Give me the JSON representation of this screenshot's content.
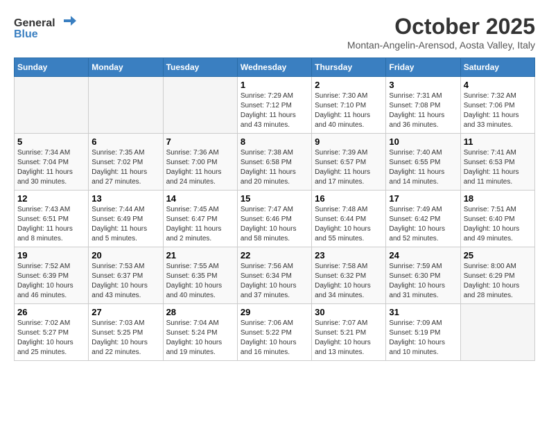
{
  "header": {
    "logo_general": "General",
    "logo_blue": "Blue",
    "month": "October 2025",
    "location": "Montan-Angelin-Arensod, Aosta Valley, Italy"
  },
  "days_of_week": [
    "Sunday",
    "Monday",
    "Tuesday",
    "Wednesday",
    "Thursday",
    "Friday",
    "Saturday"
  ],
  "weeks": [
    [
      {
        "day": "",
        "sunrise": "",
        "sunset": "",
        "daylight": ""
      },
      {
        "day": "",
        "sunrise": "",
        "sunset": "",
        "daylight": ""
      },
      {
        "day": "",
        "sunrise": "",
        "sunset": "",
        "daylight": ""
      },
      {
        "day": "1",
        "sunrise": "Sunrise: 7:29 AM",
        "sunset": "Sunset: 7:12 PM",
        "daylight": "Daylight: 11 hours and 43 minutes."
      },
      {
        "day": "2",
        "sunrise": "Sunrise: 7:30 AM",
        "sunset": "Sunset: 7:10 PM",
        "daylight": "Daylight: 11 hours and 40 minutes."
      },
      {
        "day": "3",
        "sunrise": "Sunrise: 7:31 AM",
        "sunset": "Sunset: 7:08 PM",
        "daylight": "Daylight: 11 hours and 36 minutes."
      },
      {
        "day": "4",
        "sunrise": "Sunrise: 7:32 AM",
        "sunset": "Sunset: 7:06 PM",
        "daylight": "Daylight: 11 hours and 33 minutes."
      }
    ],
    [
      {
        "day": "5",
        "sunrise": "Sunrise: 7:34 AM",
        "sunset": "Sunset: 7:04 PM",
        "daylight": "Daylight: 11 hours and 30 minutes."
      },
      {
        "day": "6",
        "sunrise": "Sunrise: 7:35 AM",
        "sunset": "Sunset: 7:02 PM",
        "daylight": "Daylight: 11 hours and 27 minutes."
      },
      {
        "day": "7",
        "sunrise": "Sunrise: 7:36 AM",
        "sunset": "Sunset: 7:00 PM",
        "daylight": "Daylight: 11 hours and 24 minutes."
      },
      {
        "day": "8",
        "sunrise": "Sunrise: 7:38 AM",
        "sunset": "Sunset: 6:58 PM",
        "daylight": "Daylight: 11 hours and 20 minutes."
      },
      {
        "day": "9",
        "sunrise": "Sunrise: 7:39 AM",
        "sunset": "Sunset: 6:57 PM",
        "daylight": "Daylight: 11 hours and 17 minutes."
      },
      {
        "day": "10",
        "sunrise": "Sunrise: 7:40 AM",
        "sunset": "Sunset: 6:55 PM",
        "daylight": "Daylight: 11 hours and 14 minutes."
      },
      {
        "day": "11",
        "sunrise": "Sunrise: 7:41 AM",
        "sunset": "Sunset: 6:53 PM",
        "daylight": "Daylight: 11 hours and 11 minutes."
      }
    ],
    [
      {
        "day": "12",
        "sunrise": "Sunrise: 7:43 AM",
        "sunset": "Sunset: 6:51 PM",
        "daylight": "Daylight: 11 hours and 8 minutes."
      },
      {
        "day": "13",
        "sunrise": "Sunrise: 7:44 AM",
        "sunset": "Sunset: 6:49 PM",
        "daylight": "Daylight: 11 hours and 5 minutes."
      },
      {
        "day": "14",
        "sunrise": "Sunrise: 7:45 AM",
        "sunset": "Sunset: 6:47 PM",
        "daylight": "Daylight: 11 hours and 2 minutes."
      },
      {
        "day": "15",
        "sunrise": "Sunrise: 7:47 AM",
        "sunset": "Sunset: 6:46 PM",
        "daylight": "Daylight: 10 hours and 58 minutes."
      },
      {
        "day": "16",
        "sunrise": "Sunrise: 7:48 AM",
        "sunset": "Sunset: 6:44 PM",
        "daylight": "Daylight: 10 hours and 55 minutes."
      },
      {
        "day": "17",
        "sunrise": "Sunrise: 7:49 AM",
        "sunset": "Sunset: 6:42 PM",
        "daylight": "Daylight: 10 hours and 52 minutes."
      },
      {
        "day": "18",
        "sunrise": "Sunrise: 7:51 AM",
        "sunset": "Sunset: 6:40 PM",
        "daylight": "Daylight: 10 hours and 49 minutes."
      }
    ],
    [
      {
        "day": "19",
        "sunrise": "Sunrise: 7:52 AM",
        "sunset": "Sunset: 6:39 PM",
        "daylight": "Daylight: 10 hours and 46 minutes."
      },
      {
        "day": "20",
        "sunrise": "Sunrise: 7:53 AM",
        "sunset": "Sunset: 6:37 PM",
        "daylight": "Daylight: 10 hours and 43 minutes."
      },
      {
        "day": "21",
        "sunrise": "Sunrise: 7:55 AM",
        "sunset": "Sunset: 6:35 PM",
        "daylight": "Daylight: 10 hours and 40 minutes."
      },
      {
        "day": "22",
        "sunrise": "Sunrise: 7:56 AM",
        "sunset": "Sunset: 6:34 PM",
        "daylight": "Daylight: 10 hours and 37 minutes."
      },
      {
        "day": "23",
        "sunrise": "Sunrise: 7:58 AM",
        "sunset": "Sunset: 6:32 PM",
        "daylight": "Daylight: 10 hours and 34 minutes."
      },
      {
        "day": "24",
        "sunrise": "Sunrise: 7:59 AM",
        "sunset": "Sunset: 6:30 PM",
        "daylight": "Daylight: 10 hours and 31 minutes."
      },
      {
        "day": "25",
        "sunrise": "Sunrise: 8:00 AM",
        "sunset": "Sunset: 6:29 PM",
        "daylight": "Daylight: 10 hours and 28 minutes."
      }
    ],
    [
      {
        "day": "26",
        "sunrise": "Sunrise: 7:02 AM",
        "sunset": "Sunset: 5:27 PM",
        "daylight": "Daylight: 10 hours and 25 minutes."
      },
      {
        "day": "27",
        "sunrise": "Sunrise: 7:03 AM",
        "sunset": "Sunset: 5:25 PM",
        "daylight": "Daylight: 10 hours and 22 minutes."
      },
      {
        "day": "28",
        "sunrise": "Sunrise: 7:04 AM",
        "sunset": "Sunset: 5:24 PM",
        "daylight": "Daylight: 10 hours and 19 minutes."
      },
      {
        "day": "29",
        "sunrise": "Sunrise: 7:06 AM",
        "sunset": "Sunset: 5:22 PM",
        "daylight": "Daylight: 10 hours and 16 minutes."
      },
      {
        "day": "30",
        "sunrise": "Sunrise: 7:07 AM",
        "sunset": "Sunset: 5:21 PM",
        "daylight": "Daylight: 10 hours and 13 minutes."
      },
      {
        "day": "31",
        "sunrise": "Sunrise: 7:09 AM",
        "sunset": "Sunset: 5:19 PM",
        "daylight": "Daylight: 10 hours and 10 minutes."
      },
      {
        "day": "",
        "sunrise": "",
        "sunset": "",
        "daylight": ""
      }
    ]
  ]
}
